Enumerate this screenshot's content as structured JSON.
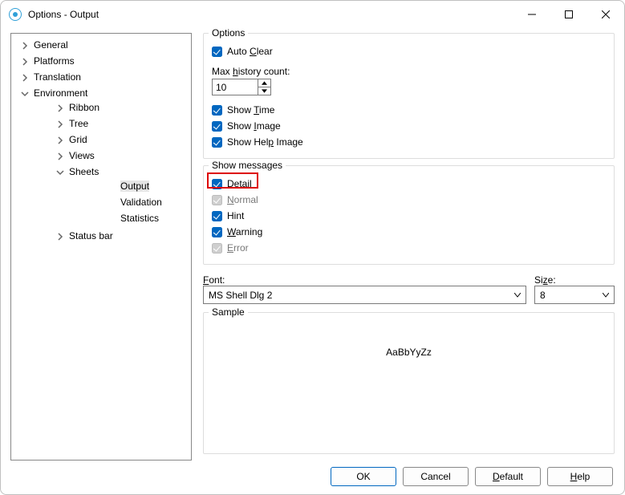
{
  "window": {
    "title": "Options - Output"
  },
  "tree": {
    "general": "General",
    "platforms": "Platforms",
    "translation": "Translation",
    "environment": "Environment",
    "ribbon": "Ribbon",
    "tree": "Tree",
    "grid": "Grid",
    "views": "Views",
    "sheets": "Sheets",
    "output": "Output",
    "validation": "Validation",
    "statistics": "Statistics",
    "statusbar": "Status bar"
  },
  "options": {
    "legend": "Options",
    "auto_clear_pre": "Auto ",
    "auto_clear_u": "C",
    "auto_clear_post": "lear",
    "max_hist_pre": "Max ",
    "max_hist_u": "h",
    "max_hist_post": "istory count:",
    "max_hist_value": "10",
    "show_time_pre": "Show ",
    "show_time_u": "T",
    "show_time_post": "ime",
    "show_image_pre": "Show ",
    "show_image_u": "I",
    "show_image_post": "mage",
    "show_help_pre": "Show Hel",
    "show_help_u": "p",
    "show_help_post": " Image"
  },
  "messages": {
    "legend": "Show messages",
    "detail": "Detail",
    "normal_u": "N",
    "normal_post": "ormal",
    "hint": "Hint",
    "warn_u": "W",
    "warn_post": "arning",
    "error_u": "E",
    "error_post": "rror"
  },
  "font": {
    "label_u": "F",
    "label_post": "ont:",
    "value": "MS Shell Dlg 2",
    "size_label_pre": "Si",
    "size_label_u": "z",
    "size_label_post": "e:",
    "size_value": "8"
  },
  "sample": {
    "legend": "Sample",
    "text": "AaBbYyZz"
  },
  "buttons": {
    "ok": "OK",
    "cancel": "Cancel",
    "default_u": "D",
    "default_post": "efault",
    "help_u": "H",
    "help_post": "elp"
  }
}
